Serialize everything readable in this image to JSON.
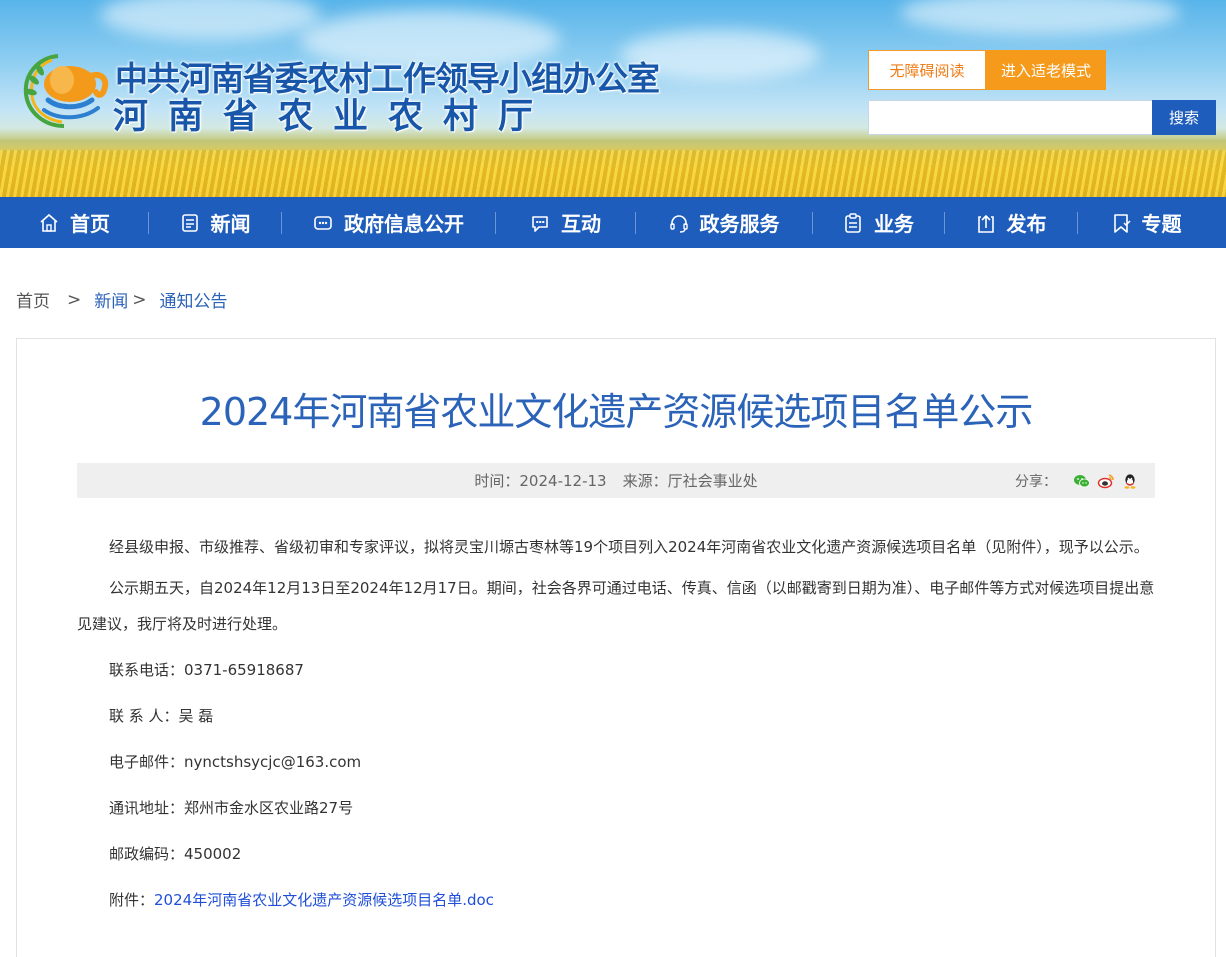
{
  "header": {
    "org_name_line1": "中共河南省委农村工作领导小组办公室",
    "org_name_line2": "河南省农业农村厅",
    "logo_icon": "elephant-wheat-emblem",
    "accessible_label": "无障碍阅读",
    "elder_mode_label": "进入适老模式",
    "search_placeholder": "",
    "search_label": "搜索"
  },
  "nav": {
    "items": [
      {
        "label": "首页",
        "icon": "home-icon"
      },
      {
        "label": "新闻",
        "icon": "news-icon"
      },
      {
        "label": "政府信息公开",
        "icon": "info-icon"
      },
      {
        "label": "互动",
        "icon": "chat-icon"
      },
      {
        "label": "政务服务",
        "icon": "headset-icon"
      },
      {
        "label": "业务",
        "icon": "clipboard-icon"
      },
      {
        "label": "发布",
        "icon": "upload-icon"
      },
      {
        "label": "专题",
        "icon": "bookmark-icon"
      }
    ]
  },
  "breadcrumb": {
    "home": "首页",
    "sep1": ">",
    "news": "新闻",
    "sep2": ">",
    "current": "通知公告"
  },
  "article": {
    "title": "2024年河南省农业文化遗产资源候选项目名单公示",
    "time": "时间：2024-12-13",
    "source": "来源：厅社会事业处",
    "share_label": "分享：",
    "share_icons": [
      "wechat-icon",
      "weibo-icon",
      "qq-icon"
    ],
    "paragraphs": [
      "经县级申报、市级推荐、省级初审和专家评议，拟将灵宝川塬古枣林等19个项目列入2024年河南省农业文化遗产资源候选项目名单（见附件），现予以公示。",
      "公示期五天，自2024年12月13日至2024年12月17日。期间，社会各界可通过电话、传真、信函（以邮戳寄到日期为准）、电子邮件等方式对候选项目提出意见建议，我厅将及时进行处理。"
    ],
    "phone": "联系电话：0371-65918687",
    "contact": "联 系 人：吴 磊",
    "email": "电子邮件：nynctshsycjc@163.com",
    "address": "通讯地址：郑州市金水区农业路27号",
    "postcode": "邮政编码：450002",
    "attachment_prefix": "附件：",
    "attachment_name": "2024年河南省农业文化遗产资源候选项目名单.doc"
  },
  "colors": {
    "primary_blue": "#1f5dbd",
    "title_blue": "#2a63b8",
    "orange": "#f59a1b",
    "link_blue": "#1f4fd8"
  }
}
